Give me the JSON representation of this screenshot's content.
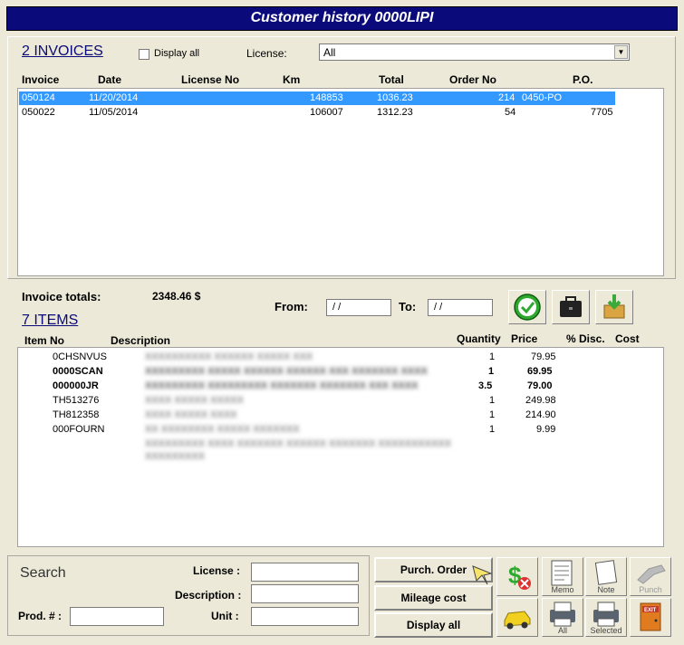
{
  "window": {
    "title": "Customer history 0000LIPI"
  },
  "invoices": {
    "title": "2  INVOICES",
    "display_all_label": "Display all",
    "license_label": "License:",
    "license_value": "All",
    "columns": [
      "Invoice",
      "Date",
      "License No",
      "Km",
      "Total",
      "Order No",
      "P.O."
    ],
    "rows": [
      {
        "invoice": "050124",
        "date": "11/20/2014",
        "license": "",
        "km": "148853",
        "total": "1036.23",
        "order": "214",
        "po": "0450-PO",
        "selected": true
      },
      {
        "invoice": "050022",
        "date": "11/05/2014",
        "license": "",
        "km": "106007",
        "total": "1312.23",
        "order": "54",
        "po": "7705",
        "selected": false
      }
    ]
  },
  "totals": {
    "label": "Invoice totals:",
    "value": "2348.46 $"
  },
  "dates": {
    "from_label": "From:",
    "from_value": "/ /",
    "to_label": "To:",
    "to_value": "/ /"
  },
  "items": {
    "title": "7  ITEMS",
    "columns": [
      "Item No",
      "Description",
      "Quantity",
      "Price",
      "% Disc.",
      "Cost"
    ],
    "rows": [
      {
        "item": "0CHSNVUS",
        "desc": "XXXXXXXXXX XXXXXX XXXXX XXX",
        "qty": "1",
        "price": "79.95",
        "bold": false
      },
      {
        "item": "0000SCAN",
        "desc": "XXXXXXXXX XXXXX XXXXXX XXXXXX XXX XXXXXXX XXXX",
        "qty": "1",
        "price": "69.95",
        "bold": true
      },
      {
        "item": "000000JR",
        "desc": "XXXXXXXXX XXXXXXXXX XXXXXXX XXXXXXX XXX XXXX",
        "qty": "3.5",
        "price": "79.00",
        "bold": true
      },
      {
        "item": "TH513276",
        "desc": "XXXX XXXXX XXXXX",
        "qty": "1",
        "price": "249.98",
        "bold": false
      },
      {
        "item": "TH812358",
        "desc": "XXXX XXXXX XXXX",
        "qty": "1",
        "price": "214.90",
        "bold": false
      },
      {
        "item": "000FOURN",
        "desc": "XX XXXXXXXX XXXXX XXXXXXX",
        "qty": "1",
        "price": "9.99",
        "bold": false
      },
      {
        "item": "",
        "desc": "XXXXXXXXX XXXX XXXXXXX XXXXXX XXXXXXX XXXXXXXXXXX",
        "qty": "",
        "price": "",
        "bold": false
      },
      {
        "item": "",
        "desc": "XXXXXXXXX",
        "qty": "",
        "price": "",
        "bold": false
      }
    ]
  },
  "search": {
    "title": "Search",
    "license_label": "License :",
    "description_label": "Description :",
    "prod_label": "Prod. # :",
    "unit_label": "Unit :"
  },
  "buttons": {
    "purch_order": "Purch. Order",
    "mileage_cost": "Mileage cost",
    "display_all": "Display all",
    "memo": "Memo",
    "note": "Note",
    "punch": "Punch",
    "all": "All",
    "selected": "Selected"
  }
}
